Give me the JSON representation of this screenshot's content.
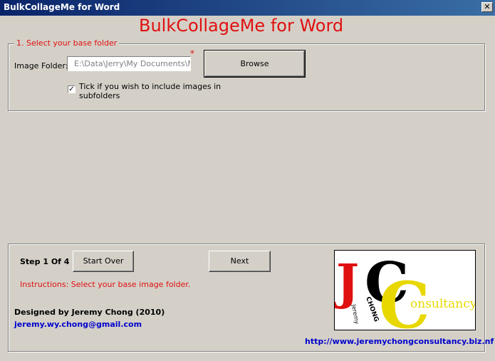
{
  "window": {
    "title": "BulkCollageMe for Word",
    "close_glyph": "✕"
  },
  "header": {
    "title": "BulkCollageMe for Word"
  },
  "step1": {
    "group_label": "1. Select your base folder",
    "folder_label": "Image Folder:",
    "folder_value": "E:\\Data\\Jerry\\My Documents\\My Pictures",
    "required_marker": "*",
    "browse_label": "Browse",
    "subfolders_checked": true,
    "subfolders_label_line1": "Tick if you wish to include images in",
    "subfolders_label_line2": "subfolders"
  },
  "footer": {
    "step_text": "Step 1 Of 4",
    "start_over_label": "Start Over",
    "next_label": "Next",
    "instructions": "Instructions: Select your base image folder.",
    "designer": "Designed by Jeremy Chong  (2010)",
    "email": "jeremy.wy.chong@gmail.com",
    "url": "http://www.jeremychongconsultancy.biz.nf"
  },
  "logo": {
    "letter_j": "J",
    "letter_c1": "C",
    "letter_c2": "C",
    "consultancy": "onsultancy",
    "jeremy": "Jeremy",
    "chong": "CHONG"
  },
  "colors": {
    "accent_red": "#e01010",
    "link_blue": "#0000cc",
    "logo_yellow": "#e8d800",
    "window_bg": "#d4d0c8"
  }
}
